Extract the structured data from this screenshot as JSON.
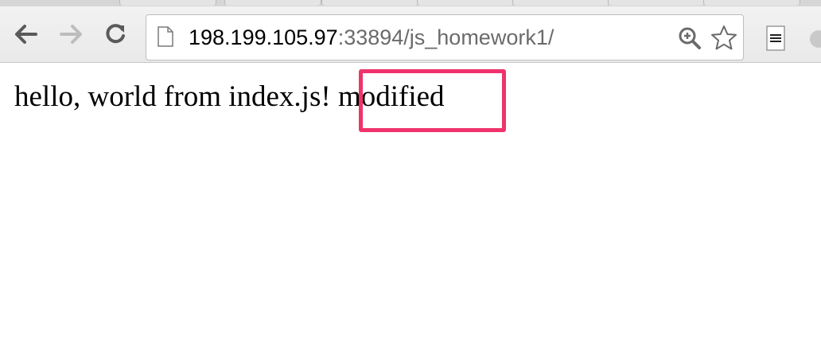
{
  "browser": {
    "address_bar": {
      "host": "198.199.105.97",
      "path": ":33894/js_homework1/"
    },
    "icons": {
      "back": "arrow-left-icon",
      "forward": "arrow-right-icon",
      "reload": "reload-icon",
      "page": "page-icon",
      "zoom": "zoom-in-icon",
      "bookmark": "star-icon",
      "extension": "document-icon"
    }
  },
  "page": {
    "text_main": "hello, world from index.js!",
    "text_modified": "modified"
  },
  "annotation": {
    "highlight_color": "#f0336d"
  }
}
